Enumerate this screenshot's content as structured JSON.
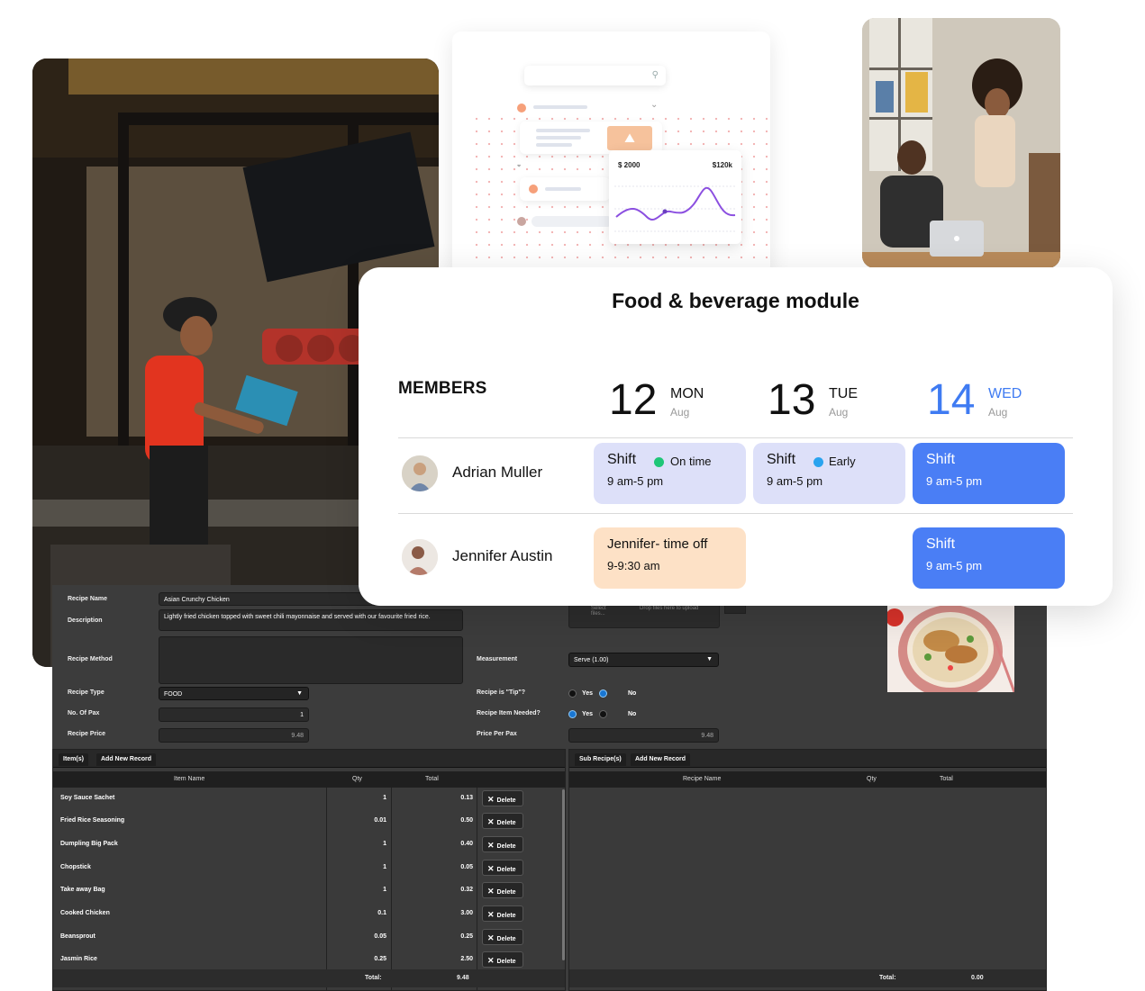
{
  "dashboard_mock": {
    "value_left": "$ 2000",
    "value_right": "$120k"
  },
  "schedule": {
    "title": "Food & beverage module",
    "members_label": "MEMBERS",
    "days": [
      {
        "num": "12",
        "dow": "MON",
        "month": "Aug",
        "active": false
      },
      {
        "num": "13",
        "dow": "TUE",
        "month": "Aug",
        "active": false
      },
      {
        "num": "14",
        "dow": "WED",
        "month": "Aug",
        "active": true
      }
    ],
    "members": [
      {
        "name": "Adrian Muller",
        "shifts": [
          {
            "title": "Shift",
            "hours": "9 am-5 pm",
            "badge": "On time",
            "badge_color": "#1ec677",
            "style": "lavender"
          },
          {
            "title": "Shift",
            "hours": "9 am-5 pm",
            "badge": "Early",
            "badge_color": "#29a3ef",
            "style": "lavender"
          },
          {
            "title": "Shift",
            "hours": "9 am-5 pm",
            "style": "blue"
          }
        ]
      },
      {
        "name": "Jennifer Austin",
        "shifts": [
          {
            "title": "Jennifer- time off",
            "hours": "9-9:30 am",
            "style": "peach"
          },
          {
            "title": "Shift",
            "hours": "9 am-5 pm",
            "style": "blue"
          }
        ]
      }
    ],
    "colors": {
      "accent": "#3f7bf2",
      "shift_blue": "#4a7ef5",
      "shift_lavender": "#dde0f9",
      "time_off": "#fde1c6"
    }
  },
  "recipe": {
    "labels": {
      "name": "Recipe Name",
      "description": "Description",
      "method": "Recipe Method",
      "type": "Recipe Type",
      "pax": "No. Of Pax",
      "price": "Recipe Price",
      "measurement": "Measurement",
      "tip": "Recipe is \"Tip\"?",
      "item_needed": "Recipe Item Needed?",
      "price_per_pax": "Price Per Pax"
    },
    "values": {
      "name": "Asian Crunchy Chicken",
      "description": "Lightly fried chicken topped with sweet chili mayonnaise and served with our favourite fried rice.",
      "method": "",
      "type": "FOOD",
      "pax": "1",
      "price": "9.48",
      "measurement": "Serve (1.00)",
      "price_per_pax": "9.48"
    },
    "radio": {
      "yes": "Yes",
      "no": "No"
    },
    "upload": {
      "select": "Select files...",
      "drop": "Drop files here to upload"
    },
    "items_table": {
      "tab_label": "Item(s)",
      "add_label": "Add New Record",
      "headers": {
        "name": "Item Name",
        "qty": "Qty",
        "total": "Total"
      },
      "delete_label": "Delete",
      "rows": [
        {
          "name": "Soy Sauce Sachet",
          "qty": "1",
          "total": "0.13"
        },
        {
          "name": "Fried Rice Seasoning",
          "qty": "0.01",
          "total": "0.50"
        },
        {
          "name": "Dumpling Big Pack",
          "qty": "1",
          "total": "0.40"
        },
        {
          "name": "Chopstick",
          "qty": "1",
          "total": "0.05"
        },
        {
          "name": "Take away Bag",
          "qty": "1",
          "total": "0.32"
        },
        {
          "name": "Cooked Chicken",
          "qty": "0.1",
          "total": "3.00"
        },
        {
          "name": "Beansprout",
          "qty": "0.05",
          "total": "0.25"
        },
        {
          "name": "Jasmin Rice",
          "qty": "0.25",
          "total": "2.50"
        }
      ],
      "total_label": "Total:",
      "total_value": "9.48"
    },
    "sub_table": {
      "tab_label": "Sub Recipe(s)",
      "add_label": "Add New Record",
      "headers": {
        "name": "Recipe Name",
        "qty": "Qty",
        "total": "Total"
      },
      "total_label": "Total:",
      "total_value": "0.00"
    }
  }
}
